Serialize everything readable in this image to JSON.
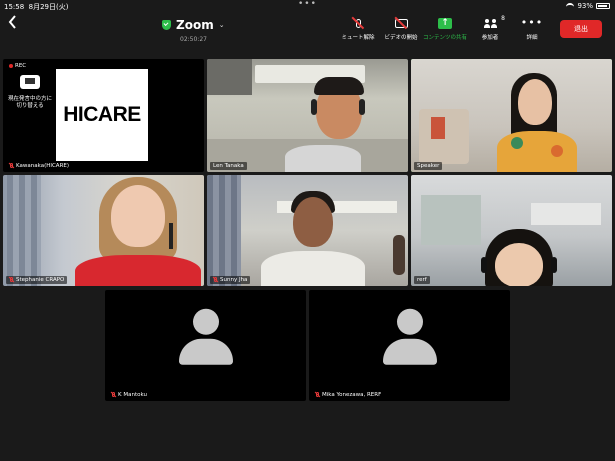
{
  "status_bar": {
    "time": "15:58",
    "date": "8月29日(火)",
    "battery_percent": "93%",
    "battery_level": 0.93,
    "dots": "•••"
  },
  "header": {
    "back_icon": "chevron-left-icon",
    "title": "Zoom",
    "title_caret": "⌄",
    "secure_icon": "shield-check-icon",
    "timer": "02:50:27"
  },
  "toolbar": {
    "items": [
      {
        "label": "ミュート解除",
        "icon": "mic-muted-icon"
      },
      {
        "label": "ビデオの開始",
        "icon": "video-off-icon"
      },
      {
        "label": "コンテンツの共有",
        "icon": "share-screen-icon",
        "color": "#2dbe4a"
      },
      {
        "label": "参加者",
        "icon": "participants-icon",
        "count": "8"
      },
      {
        "label": "詳細",
        "icon": "more-icon"
      }
    ],
    "leave_label": "退出",
    "leave_color": "#e02828"
  },
  "rec_label": "REC",
  "share_switch_label": "現在発言中の方に切り替える",
  "hicare_text": "HICARE",
  "participants": [
    {
      "name": "Kawanaka(HICARE)",
      "muted": true
    },
    {
      "name": "Len Tanaka",
      "muted": false
    },
    {
      "name": "Speaker",
      "muted": false,
      "active": true
    },
    {
      "name": "Stephanie CRAPO",
      "muted": true
    },
    {
      "name": "Sunny   Jha",
      "muted": true
    },
    {
      "name": "rerf",
      "muted": false
    },
    {
      "name": "K Mantoku",
      "muted": true,
      "video_off": true
    },
    {
      "name": "Mika Yonezawa, RERF",
      "muted": true,
      "video_off": true
    }
  ],
  "colors": {
    "background": "#1a1a1a",
    "active_speaker_border": "#3ad14a",
    "muted_icon": "#e63a3a"
  }
}
